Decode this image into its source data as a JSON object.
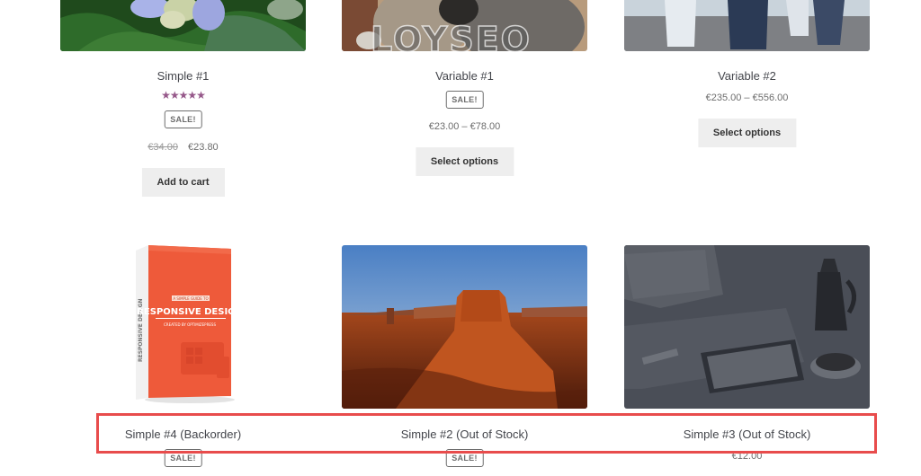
{
  "products_row1": [
    {
      "name": "Simple #1",
      "rating": "5 of 5 stars",
      "stars": "★★★★★",
      "sale_badge": "SALE!",
      "price_old": "€34.00",
      "price_new": "€23.80",
      "button": "Add to cart",
      "image": "hydrangea-flower"
    },
    {
      "name": "Variable #1",
      "sale_badge": "SALE!",
      "price": "€23.00 – €78.00",
      "button": "Select options",
      "image": "koala"
    },
    {
      "name": "Variable #2",
      "price": "€235.00 – €556.00",
      "button": "Select options",
      "image": "penguins"
    }
  ],
  "products_row2": [
    {
      "name": "Simple #4 (Backorder)",
      "sale_badge": "SALE!",
      "image": "responsive-design-book",
      "book_cover": {
        "kicker": "A SIMPLE GUIDE TO",
        "title": "RESPONSIVE DESIGN",
        "subtitle": "CREATED BY OPTIMIZEPRESS",
        "spine": "RESPONSIVE DESIGN"
      }
    },
    {
      "name": "Simple #2 (Out of Stock)",
      "sale_badge": "SALE!",
      "image": "desert-monument-valley"
    },
    {
      "name": "Simple #3 (Out of Stock)",
      "price": "€12.00",
      "image": "desk-coffee-tablet"
    }
  ],
  "watermark": "LOYSEO",
  "colors": {
    "highlight": "#e84c4c",
    "star": "#96588a",
    "button_bg": "#eeeeee"
  }
}
